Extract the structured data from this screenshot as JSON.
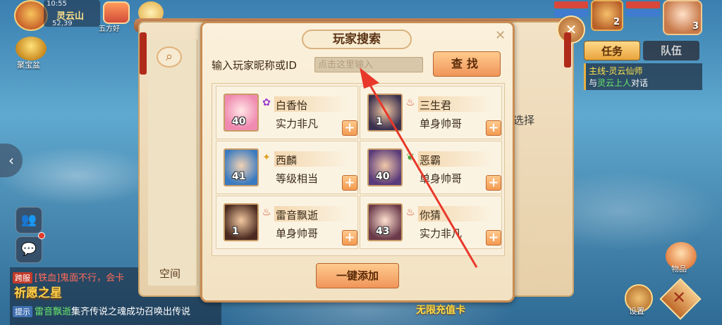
{
  "hud": {
    "time": "10:55",
    "location": "灵云山",
    "coords": "52,39",
    "event_label": "五方好",
    "treasure_label": "聚宝盆",
    "pet_level": "2",
    "hero_level": "3"
  },
  "task_panel": {
    "tab_task": "任务",
    "tab_team": "队伍",
    "quest_line1": "主线-灵云仙师",
    "quest_npc": "灵云上人",
    "quest_prefix": "与",
    "quest_suffix": "对话"
  },
  "chat": {
    "line1_tag": "跨服",
    "line1_text": "[铁血]鬼面不行，会卡",
    "banner": "祈愿之星",
    "line2_tag": "提示",
    "line2_name": "雷音飘逝",
    "line2_text": "集齐传说之魂成功召唤出传说"
  },
  "background_panel": {
    "space_label": "空间",
    "choose_label": "选择"
  },
  "bottom_right": {
    "items_label": "物品",
    "settings_label": "设置",
    "recharge_label": "无限充值卡"
  },
  "dialog": {
    "title": "玩家搜索",
    "input_label": "输入玩家昵称或ID",
    "input_placeholder": "点击这里输入",
    "input_value": "",
    "find_button": "查找",
    "add_all_button": "一键添加",
    "players": [
      {
        "name": "白香怡",
        "level": "40",
        "desc": "实力非凡",
        "school": "purple-lotus-icon"
      },
      {
        "name": "三生君",
        "level": "1",
        "desc": "单身帅哥",
        "school": "flame-icon"
      },
      {
        "name": "西麟",
        "level": "41",
        "desc": "等级相当",
        "school": "star-icon"
      },
      {
        "name": "恶霸",
        "level": "40",
        "desc": "单身帅哥",
        "school": "leaf-icon"
      },
      {
        "name": "雷音飘逝",
        "level": "1",
        "desc": "单身帅哥",
        "school": "flame-icon"
      },
      {
        "name": "你猜",
        "level": "43",
        "desc": "实力非凡",
        "school": "flame-icon"
      }
    ]
  },
  "colors": {
    "dialog_bg": "#fbf1dc",
    "button_orange": "#f0955a",
    "annotation_arrow": "#e8382a"
  }
}
